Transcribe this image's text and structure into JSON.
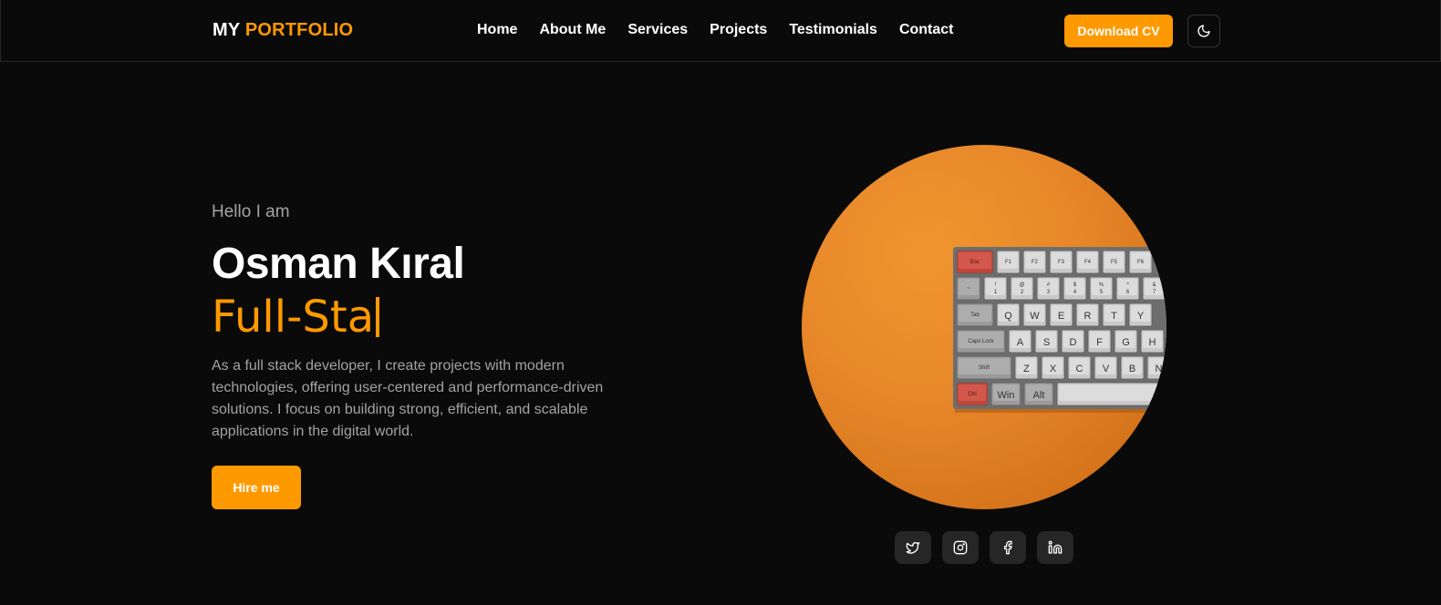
{
  "nav": {
    "logo_part1": "MY",
    "logo_part2": "PORTFOLIO",
    "links": [
      "Home",
      "About Me",
      "Services",
      "Projects",
      "Testimonials",
      "Contact"
    ],
    "download_label": "Download CV",
    "theme_icon": "moon-icon"
  },
  "hero": {
    "greeting": "Hello I am",
    "name": "Osman Kıral",
    "role_typed": "Full-Sta",
    "description": "As a full stack developer, I create projects with modern technologies, offering user-centered and performance-driven solutions. I focus on building strong, efficient, and scalable applications in the digital world.",
    "hire_label": "Hire me"
  },
  "keyboard": {
    "rows": [
      [
        "Esc",
        "F1",
        "F2",
        "F3",
        "F4",
        "F5",
        "F6"
      ],
      [
        "~",
        "!\n1",
        "@\n2",
        "#\n3",
        "$\n4",
        "%\n5",
        "^\n6",
        "&\n7"
      ],
      [
        "Tab",
        "Q",
        "W",
        "E",
        "R",
        "T",
        "Y"
      ],
      [
        "Caps Lock",
        "A",
        "S",
        "D",
        "F",
        "G",
        "H"
      ],
      [
        "Shift",
        "Z",
        "X",
        "C",
        "V",
        "B",
        "N"
      ],
      [
        "Ctrl",
        "Win",
        "Alt",
        ""
      ]
    ]
  },
  "socials": [
    "twitter-icon",
    "instagram-icon",
    "facebook-icon",
    "linkedin-icon"
  ],
  "colors": {
    "accent": "#ff9900",
    "background": "#0a0a0a",
    "muted_text": "#a3a3a3",
    "social_bg": "#262626"
  }
}
